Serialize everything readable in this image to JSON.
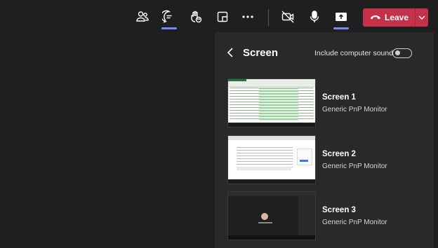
{
  "toolbar": {
    "icons": [
      "people-icon",
      "chat-icon",
      "raise-hand-icon",
      "rooms-icon",
      "more-icon",
      "camera-off-icon",
      "microphone-icon",
      "share-icon"
    ],
    "leave_label": "Leave"
  },
  "share_panel": {
    "title": "Screen",
    "include_sound_label": "Include computer sound",
    "include_sound_on": false,
    "screens": [
      {
        "name": "Screen 1",
        "monitor": "Generic PnP Monitor"
      },
      {
        "name": "Screen 2",
        "monitor": "Generic PnP Monitor"
      },
      {
        "name": "Screen 3",
        "monitor": "Generic PnP Monitor"
      }
    ]
  },
  "colors": {
    "leave_red": "#c4314b",
    "accent_underline": "#7f85f5",
    "panel_bg": "#292929"
  }
}
